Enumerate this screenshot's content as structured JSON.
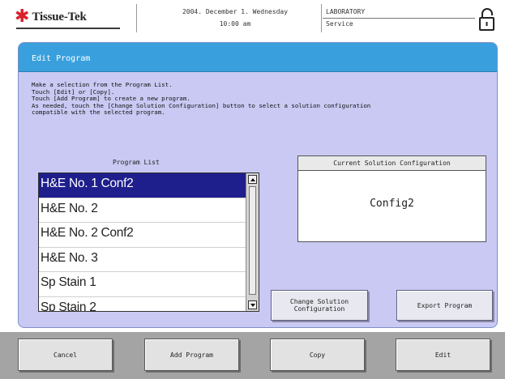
{
  "header": {
    "brand": "Tissue-Tek",
    "date": "2004. December  1. Wednesday",
    "time": "10:00  am",
    "location_top": "LABORATORY",
    "location_bottom": "Service"
  },
  "panel": {
    "title": "Edit Program",
    "instructions": [
      "Make a selection from the Program List.",
      "Touch [Edit] or [Copy].",
      "Touch [Add Program] to create a new program.",
      "As needed, touch the [Change Solution Configuration] button to select a solution configuration",
      "compatible with the selected program."
    ],
    "program_list": {
      "title": "Program List",
      "items": [
        {
          "label": "H&E No. 1 Conf2",
          "selected": true
        },
        {
          "label": "H&E No. 2",
          "selected": false
        },
        {
          "label": "H&E No. 2 Conf2",
          "selected": false
        },
        {
          "label": "H&E No. 3",
          "selected": false
        },
        {
          "label": "Sp Stain 1",
          "selected": false
        },
        {
          "label": "Sp Stain 2",
          "selected": false
        }
      ]
    },
    "current_config": {
      "title": "Current Solution Configuration",
      "value": "Config2"
    },
    "change_config_label_1": "Change Solution",
    "change_config_label_2": "Configuration",
    "export_label": "Export Program"
  },
  "footer": {
    "cancel_label": "Cancel",
    "add_label": "Add Program",
    "copy_label": "Copy",
    "edit_label": "Edit"
  },
  "colors": {
    "title_bar": "#39a0dd",
    "panel_bg": "#c9c9f3",
    "selected_row": "#1e1e8c",
    "logo_star": "#d8202a"
  },
  "icons": [
    "lock-icon",
    "tissue-tek-star-icon",
    "scroll-up-icon",
    "scroll-down-icon"
  ]
}
